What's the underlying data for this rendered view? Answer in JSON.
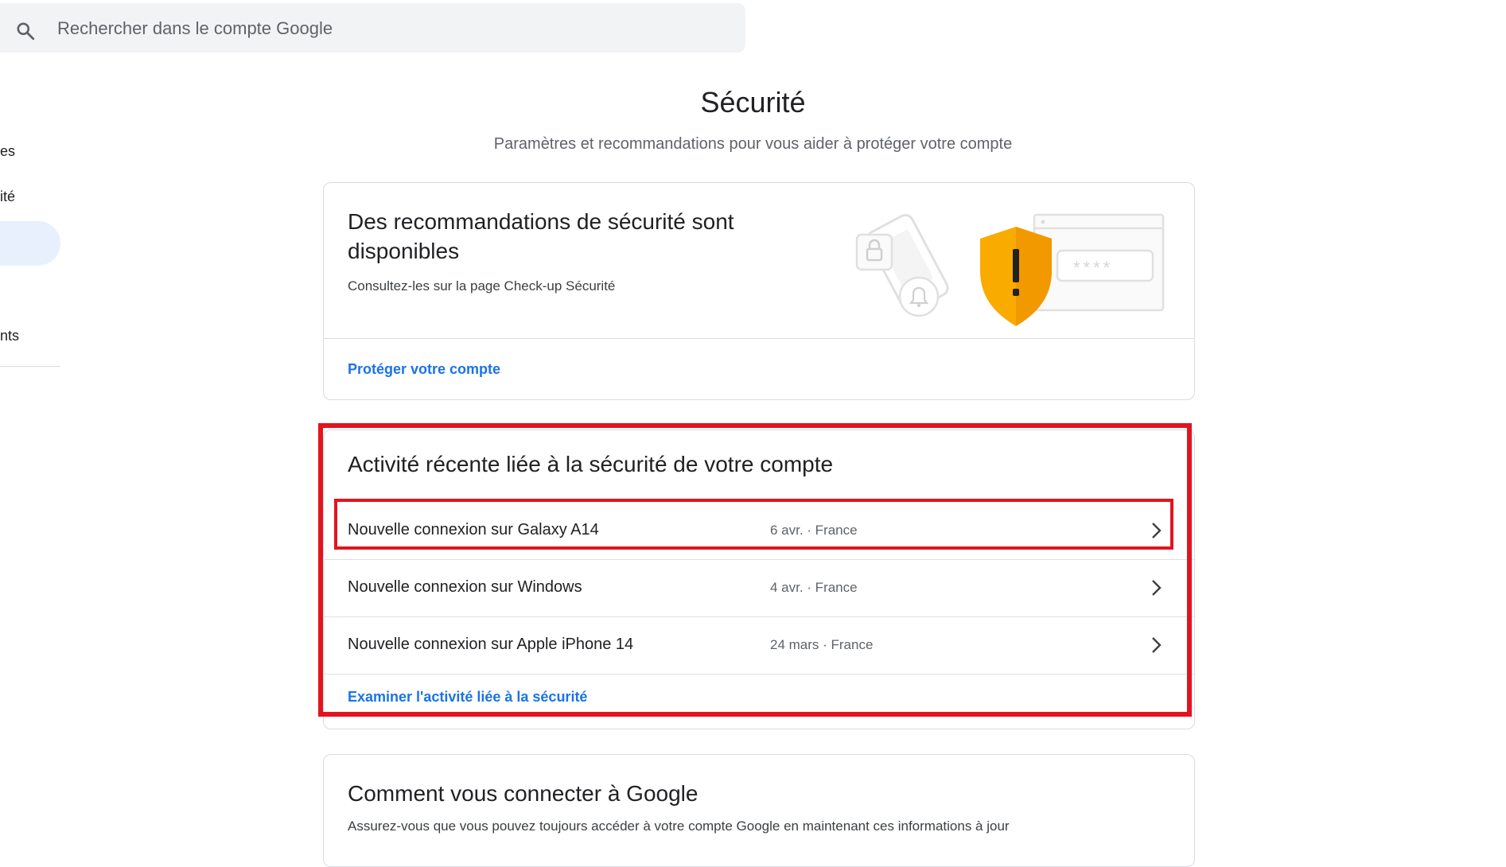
{
  "search": {
    "placeholder": "Rechercher dans le compte Google"
  },
  "sidebar": {
    "items": [
      {
        "label": "es"
      },
      {
        "label": "ité"
      },
      {
        "label": "nts"
      }
    ]
  },
  "page": {
    "title": "Sécurité",
    "subtitle": "Paramètres et recommandations pour vous aider à protéger votre compte"
  },
  "recommendations_card": {
    "title_line1": "Des recommandations de sécurité sont",
    "title_line2": "disponibles",
    "description": "Consultez-les sur la page Check-up Sécurité",
    "link": "Protéger votre compte",
    "illustration_password_mask": "****",
    "illustration_alert": "!"
  },
  "activity_card": {
    "title": "Activité récente liée à la sécurité de votre compte",
    "rows": [
      {
        "label": "Nouvelle connexion sur Galaxy A14",
        "meta": "6 avr. · France"
      },
      {
        "label": "Nouvelle connexion sur Windows",
        "meta": "4 avr. · France"
      },
      {
        "label": "Nouvelle connexion sur Apple iPhone 14",
        "meta": "24 mars · France"
      }
    ],
    "link": "Examiner l'activité liée à la sécurité"
  },
  "signin_card": {
    "title": "Comment vous connecter à Google",
    "description": "Assurez-vous que vous pouvez toujours accéder à votre compte Google en maintenant ces informations à jour"
  },
  "colors": {
    "accent": "#1a73e8",
    "highlight": "#e3141f",
    "shield": "#f9ab00",
    "sidebar_active": "#e8f0fe"
  }
}
